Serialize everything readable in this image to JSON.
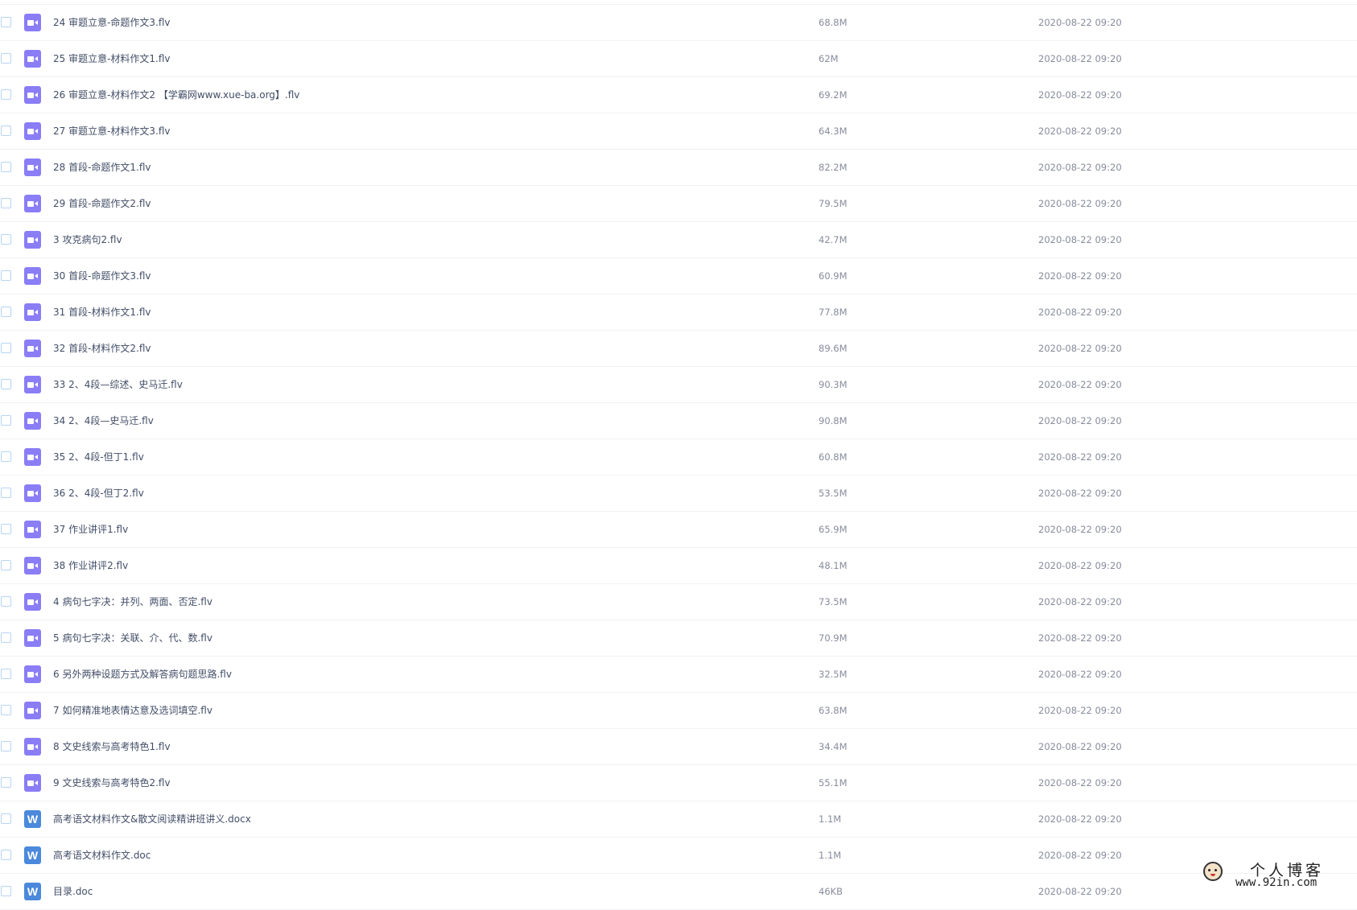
{
  "files": [
    {
      "name": "24 审题立意-命题作文3.flv",
      "size": "68.8M",
      "date": "2020-08-22 09:20",
      "type": "video"
    },
    {
      "name": "25 审题立意-材料作文1.flv",
      "size": "62M",
      "date": "2020-08-22 09:20",
      "type": "video"
    },
    {
      "name": "26 审题立意-材料作文2 【学霸网www.xue-ba.org】.flv",
      "size": "69.2M",
      "date": "2020-08-22 09:20",
      "type": "video"
    },
    {
      "name": "27 审题立意-材料作文3.flv",
      "size": "64.3M",
      "date": "2020-08-22 09:20",
      "type": "video"
    },
    {
      "name": "28 首段-命题作文1.flv",
      "size": "82.2M",
      "date": "2020-08-22 09:20",
      "type": "video"
    },
    {
      "name": "29 首段-命题作文2.flv",
      "size": "79.5M",
      "date": "2020-08-22 09:20",
      "type": "video"
    },
    {
      "name": "3 攻克病句2.flv",
      "size": "42.7M",
      "date": "2020-08-22 09:20",
      "type": "video"
    },
    {
      "name": "30 首段-命题作文3.flv",
      "size": "60.9M",
      "date": "2020-08-22 09:20",
      "type": "video"
    },
    {
      "name": "31 首段-材料作文1.flv",
      "size": "77.8M",
      "date": "2020-08-22 09:20",
      "type": "video"
    },
    {
      "name": "32 首段-材料作文2.flv",
      "size": "89.6M",
      "date": "2020-08-22 09:20",
      "type": "video"
    },
    {
      "name": "33 2、4段—综述、史马迁.flv",
      "size": "90.3M",
      "date": "2020-08-22 09:20",
      "type": "video"
    },
    {
      "name": "34 2、4段—史马迁.flv",
      "size": "90.8M",
      "date": "2020-08-22 09:20",
      "type": "video"
    },
    {
      "name": "35 2、4段-但丁1.flv",
      "size": "60.8M",
      "date": "2020-08-22 09:20",
      "type": "video"
    },
    {
      "name": "36 2、4段-但丁2.flv",
      "size": "53.5M",
      "date": "2020-08-22 09:20",
      "type": "video"
    },
    {
      "name": "37 作业讲评1.flv",
      "size": "65.9M",
      "date": "2020-08-22 09:20",
      "type": "video"
    },
    {
      "name": "38 作业讲评2.flv",
      "size": "48.1M",
      "date": "2020-08-22 09:20",
      "type": "video"
    },
    {
      "name": "4 病句七字决：并列、两面、否定.flv",
      "size": "73.5M",
      "date": "2020-08-22 09:20",
      "type": "video"
    },
    {
      "name": "5 病句七字决：关联、介、代、数.flv",
      "size": "70.9M",
      "date": "2020-08-22 09:20",
      "type": "video"
    },
    {
      "name": "6 另外两种设题方式及解答病句题思路.flv",
      "size": "32.5M",
      "date": "2020-08-22 09:20",
      "type": "video"
    },
    {
      "name": "7 如何精准地表情达意及选词填空.flv",
      "size": "63.8M",
      "date": "2020-08-22 09:20",
      "type": "video"
    },
    {
      "name": "8 文史线索与高考特色1.flv",
      "size": "34.4M",
      "date": "2020-08-22 09:20",
      "type": "video"
    },
    {
      "name": "9 文史线索与高考特色2.flv",
      "size": "55.1M",
      "date": "2020-08-22 09:20",
      "type": "video"
    },
    {
      "name": "高考语文材料作文&散文阅读精讲班讲义.docx",
      "size": "1.1M",
      "date": "2020-08-22 09:20",
      "type": "doc"
    },
    {
      "name": "高考语文材料作文.doc",
      "size": "1.1M",
      "date": "2020-08-22 09:20",
      "type": "doc"
    },
    {
      "name": "目录.doc",
      "size": "46KB",
      "date": "2020-08-22 09:20",
      "type": "doc"
    }
  ],
  "watermark": {
    "title": "个人博客",
    "url": "www.92in.com"
  }
}
